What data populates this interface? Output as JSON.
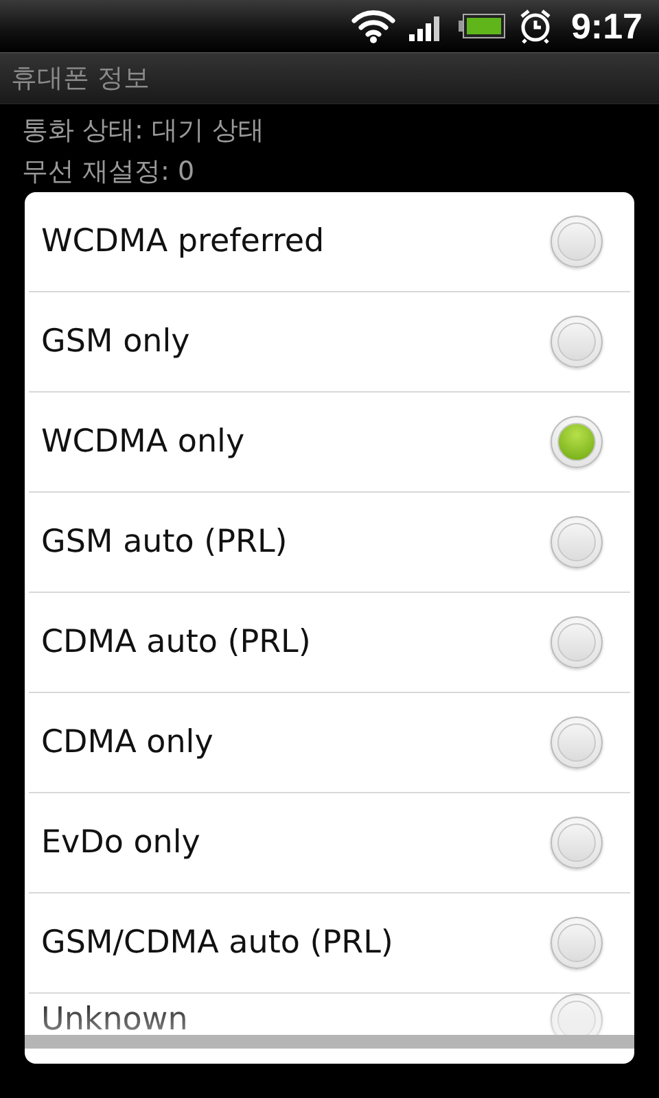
{
  "status_bar": {
    "time": "9:17"
  },
  "title_bar": {
    "title": "휴대폰 정보"
  },
  "info_lines": [
    "통화 상태: 대기 상태",
    "무선 재설정: 0"
  ],
  "dialog": {
    "options": [
      {
        "label": "WCDMA preferred",
        "selected": false
      },
      {
        "label": "GSM only",
        "selected": false
      },
      {
        "label": "WCDMA only",
        "selected": true
      },
      {
        "label": "GSM auto (PRL)",
        "selected": false
      },
      {
        "label": "CDMA auto (PRL)",
        "selected": false
      },
      {
        "label": "CDMA only",
        "selected": false
      },
      {
        "label": "EvDo only",
        "selected": false
      },
      {
        "label": "GSM/CDMA auto (PRL)",
        "selected": false
      },
      {
        "label": "Unknown",
        "selected": false
      }
    ]
  }
}
